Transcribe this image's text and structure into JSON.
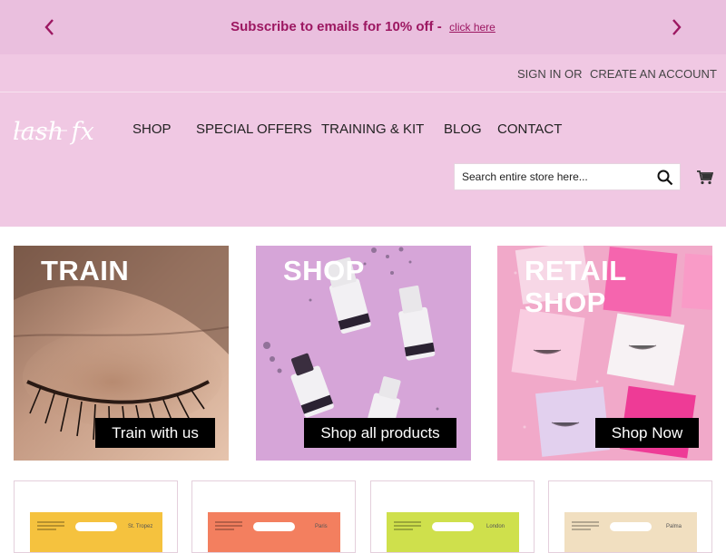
{
  "promo": {
    "text": "Subscribe to emails for 10% off -",
    "link": "click here",
    "accent": "#9c1761",
    "background": "#eabfde",
    "prev_icon": "chevron-left-icon",
    "next_icon": "chevron-right-icon"
  },
  "account": {
    "sign_in": "SIGN IN",
    "or": "OR",
    "create_account": "CREATE AN ACCOUNT"
  },
  "header": {
    "background": "#f0c8e3",
    "logo_text": "lash fx",
    "nav": [
      "SHOP",
      "SPECIAL OFFERS",
      "TRAINING & KIT",
      "BLOG",
      "CONTACT"
    ],
    "search_placeholder": "Search entire store here...",
    "search_icon": "search-icon",
    "cart_icon": "cart-icon"
  },
  "tiles": [
    {
      "title": "TRAIN",
      "button": "Train with us"
    },
    {
      "title": "SHOP",
      "button": "Shop all products"
    },
    {
      "title": "RETAIL SHOP",
      "button": "Shop Now"
    }
  ],
  "products": [
    {
      "name": "St. Tropez",
      "color": "#f5c23e"
    },
    {
      "name": "Paris",
      "color": "#f37f5f"
    },
    {
      "name": "London",
      "color": "#cfe04c"
    },
    {
      "name": "Palma",
      "color": "#f1dfc0"
    }
  ]
}
